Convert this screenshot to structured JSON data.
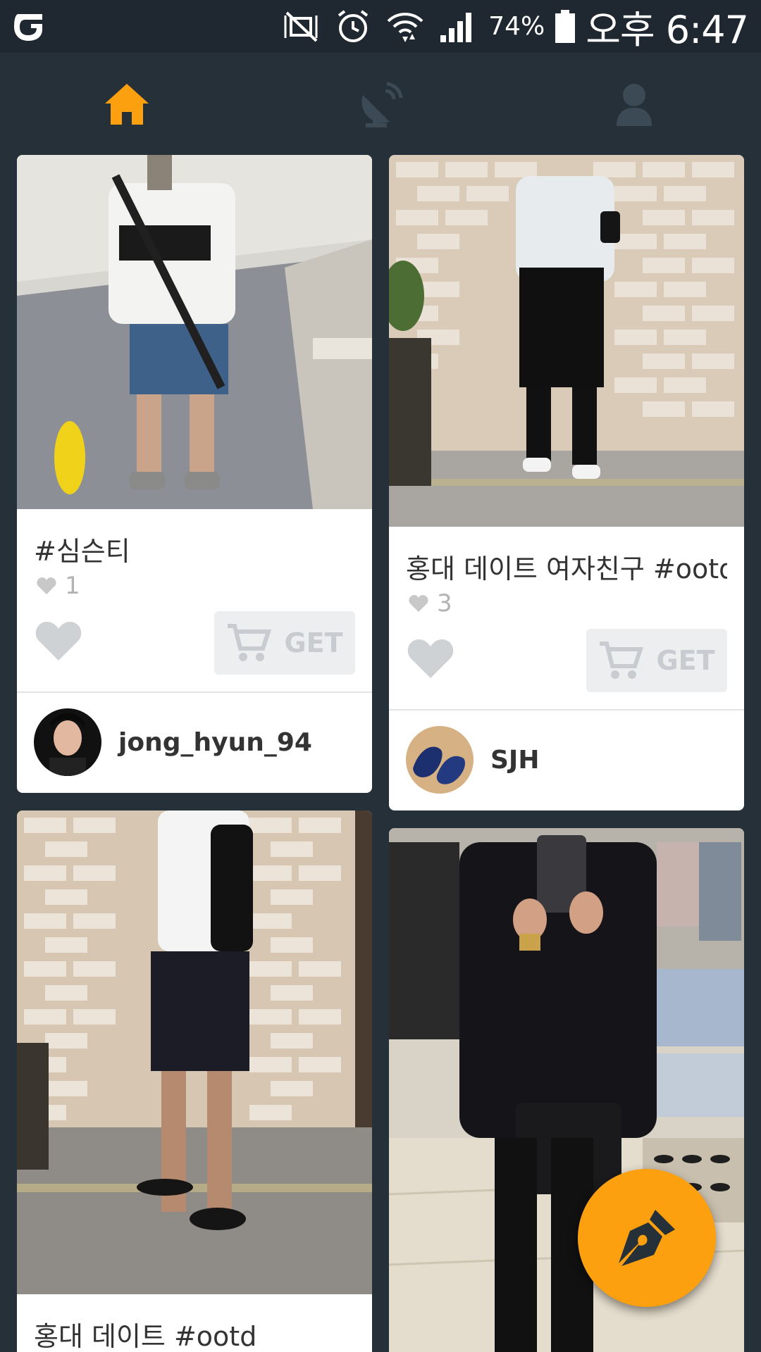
{
  "status_bar": {
    "battery_percent": "74%",
    "time": "오후 6:47"
  },
  "nav": {
    "tabs": [
      {
        "icon": "home-icon",
        "active": true
      },
      {
        "icon": "satellite-dish-icon",
        "active": false
      },
      {
        "icon": "user-profile-icon",
        "active": false
      }
    ],
    "active_color": "#fda00f",
    "inactive_color": "#3b4a55"
  },
  "feed": {
    "posts": [
      {
        "caption": "#심슨티",
        "likes": "1",
        "get_label": "GET",
        "author": "jong_hyun_94"
      },
      {
        "caption": "홍대 데이트 여자친구 #ootd",
        "likes": "3",
        "get_label": "GET",
        "author": "SJH"
      },
      {
        "caption": "홍대 데이트 #ootd"
      },
      {}
    ]
  },
  "fab": {
    "icon": "pen-nib-icon",
    "color": "#fda00f"
  }
}
